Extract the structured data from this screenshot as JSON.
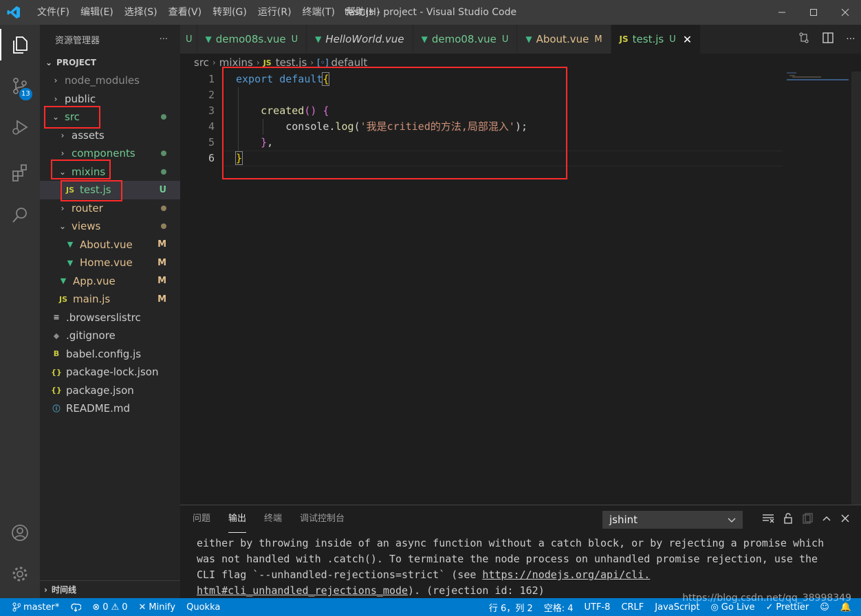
{
  "titlebar": {
    "menu": [
      "文件(F)",
      "编辑(E)",
      "选择(S)",
      "查看(V)",
      "转到(G)",
      "运行(R)",
      "终端(T)",
      "帮助(H)"
    ],
    "title": "test.js - project - Visual Studio Code"
  },
  "activity": {
    "scm_badge": "13"
  },
  "sidebar": {
    "title": "资源管理器",
    "more": "···",
    "project": "PROJECT",
    "items": [
      {
        "label": "node_modules",
        "indent": 0,
        "chev": "›",
        "icon": "",
        "status": "",
        "color": "gray"
      },
      {
        "label": "public",
        "indent": 0,
        "chev": "›",
        "icon": "",
        "status": "",
        "color": "default"
      },
      {
        "label": "src",
        "indent": 0,
        "chev": "⌄",
        "icon": "",
        "status": "dot",
        "color": "green"
      },
      {
        "label": "assets",
        "indent": 1,
        "chev": "›",
        "icon": "",
        "status": "",
        "color": "default"
      },
      {
        "label": "components",
        "indent": 1,
        "chev": "›",
        "icon": "",
        "status": "dot",
        "color": "green"
      },
      {
        "label": "mixins",
        "indent": 1,
        "chev": "⌄",
        "icon": "",
        "status": "dot",
        "color": "green"
      },
      {
        "label": "test.js",
        "indent": 2,
        "chev": "",
        "icon": "JS",
        "status": "U",
        "color": "green"
      },
      {
        "label": "router",
        "indent": 1,
        "chev": "›",
        "icon": "",
        "status": "dot",
        "color": "yellow"
      },
      {
        "label": "views",
        "indent": 1,
        "chev": "⌄",
        "icon": "",
        "status": "dot",
        "color": "yellow"
      },
      {
        "label": "About.vue",
        "indent": 2,
        "chev": "",
        "icon": "V",
        "status": "M",
        "color": "yellow"
      },
      {
        "label": "Home.vue",
        "indent": 2,
        "chev": "",
        "icon": "V",
        "status": "M",
        "color": "yellow"
      },
      {
        "label": "App.vue",
        "indent": 1,
        "chev": "",
        "icon": "V",
        "status": "M",
        "color": "yellow"
      },
      {
        "label": "main.js",
        "indent": 1,
        "chev": "",
        "icon": "JS",
        "status": "M",
        "color": "yellow"
      },
      {
        "label": ".browserslistrc",
        "indent": 0,
        "chev": "",
        "icon": "≡",
        "status": "",
        "color": "default"
      },
      {
        "label": ".gitignore",
        "indent": 0,
        "chev": "",
        "icon": "◆",
        "status": "",
        "color": "default"
      },
      {
        "label": "babel.config.js",
        "indent": 0,
        "chev": "",
        "icon": "B",
        "status": "",
        "color": "default"
      },
      {
        "label": "package-lock.json",
        "indent": 0,
        "chev": "",
        "icon": "{}",
        "status": "",
        "color": "default"
      },
      {
        "label": "package.json",
        "indent": 0,
        "chev": "",
        "icon": "{}",
        "status": "",
        "color": "default"
      },
      {
        "label": "README.md",
        "indent": 0,
        "chev": "",
        "icon": "ⓘ",
        "status": "",
        "color": "default"
      }
    ],
    "timeline": "时间线"
  },
  "tabs": [
    {
      "label": "",
      "icon": "",
      "status": "U",
      "status_color": "green",
      "italic": false,
      "active": false
    },
    {
      "label": "demo08s.vue",
      "icon": "V",
      "status": "U",
      "status_color": "green",
      "italic": false,
      "active": false
    },
    {
      "label": "HelloWorld.vue",
      "icon": "V",
      "status": "",
      "status_color": "",
      "italic": true,
      "active": false
    },
    {
      "label": "demo08.vue",
      "icon": "V",
      "status": "U",
      "status_color": "green",
      "italic": false,
      "active": false
    },
    {
      "label": "About.vue",
      "icon": "V",
      "status": "M",
      "status_color": "yellow",
      "italic": false,
      "active": false
    },
    {
      "label": "test.js",
      "icon": "JS",
      "status": "U",
      "status_color": "green",
      "italic": false,
      "active": true
    }
  ],
  "breadcrumb": {
    "parts": [
      "src",
      "mixins",
      "test.js",
      "default"
    ]
  },
  "editor": {
    "line_numbers": [
      "1",
      "2",
      "3",
      "4",
      "5",
      "6"
    ],
    "code": {
      "l1_kw": "export default",
      "l1_brace": "{",
      "l3_fn": "created",
      "l3_paren": "()",
      "l3_brace": "{",
      "l4_obj": "console.",
      "l4_fn": "log",
      "l4_open": "(",
      "l4_str": "'我是critied的方法,局部混入'",
      "l4_close": ");",
      "l5_brace": "}",
      "l5_comma": ",",
      "l6_brace": "}"
    }
  },
  "panel": {
    "tabs": [
      "问题",
      "输出",
      "终端",
      "调试控制台"
    ],
    "active_tab": "输出",
    "select_value": "jshint",
    "output_lines": [
      "either by throwing inside of an async function without a catch block, or by rejecting a promise which",
      "was not handled with .catch(). To terminate the node process on unhandled promise rejection, use the",
      "CLI flag `--unhandled-rejections=strict` (see ",
      "). (rejection id: 162)"
    ],
    "link_part1": "https://nodejs.org/api/cli.",
    "link_part2": "html#cli_unhandled_rejections_mode"
  },
  "statusbar": {
    "branch": "master*",
    "errors": "0",
    "warnings": "0",
    "minify": "Minify",
    "quokka": "Quokka",
    "position": "行 6，列 2",
    "spaces": "空格: 4",
    "encoding": "UTF-8",
    "eol": "CRLF",
    "language": "JavaScript",
    "golive": "Go Live",
    "prettier": "Prettier"
  },
  "watermark": "https://blog.csdn.net/qq_38998349",
  "colors": {
    "accent": "#007acc",
    "highlight_border": "#ff2a2a",
    "git_untracked": "#73c991",
    "git_modified": "#e2c08d"
  }
}
